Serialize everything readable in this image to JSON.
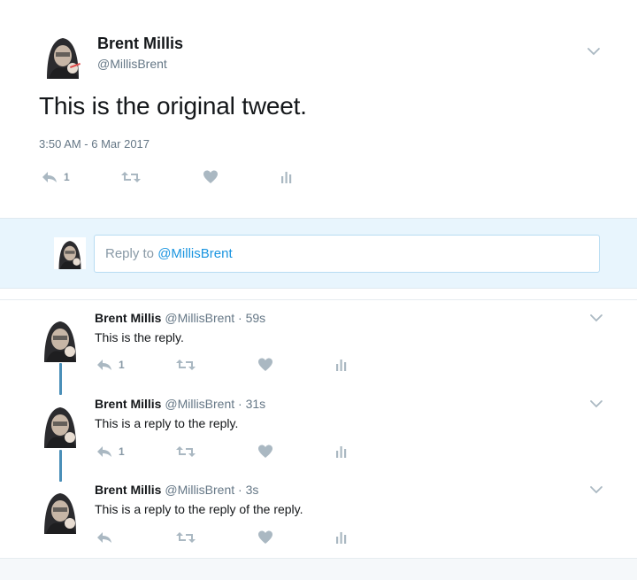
{
  "main_tweet": {
    "name": "Brent Millis",
    "handle": "@MillisBrent",
    "text": "This is the original tweet.",
    "timestamp": "3:50 AM - 6 Mar 2017",
    "reply_count": "1"
  },
  "reply_box": {
    "prefix": "Reply to ",
    "mention": "@MillisBrent"
  },
  "replies": [
    {
      "name": "Brent Millis",
      "handle": "@MillisBrent",
      "time": "· 59s",
      "text": "This is the reply.",
      "reply_count": "1"
    },
    {
      "name": "Brent Millis",
      "handle": "@MillisBrent",
      "time": "· 31s",
      "text": "This is a reply to the reply.",
      "reply_count": "1"
    },
    {
      "name": "Brent Millis",
      "handle": "@MillisBrent",
      "time": "· 3s",
      "text": "This is a reply to the reply of the reply.",
      "reply_count": ""
    }
  ],
  "icons": {
    "reply": "reply-icon",
    "retweet": "retweet-icon",
    "like": "heart-icon",
    "analytics": "analytics-icon",
    "chevron": "chevron-down-icon",
    "avatar": "avatar"
  },
  "colors": {
    "icon_gray": "#aab8c2",
    "link_blue": "#1b95e0",
    "thread_line": "#4a8fb8",
    "reply_bg": "#e8f5fd"
  }
}
